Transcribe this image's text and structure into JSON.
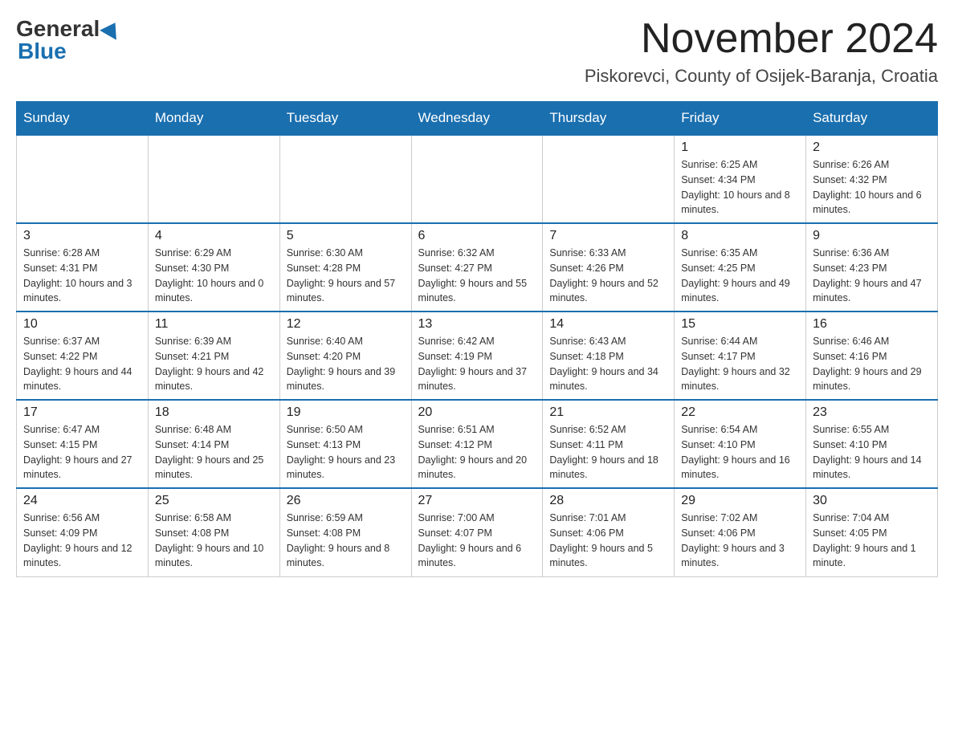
{
  "logo": {
    "general": "General",
    "blue": "Blue"
  },
  "title": "November 2024",
  "location": "Piskorevci, County of Osijek-Baranja, Croatia",
  "days_of_week": [
    "Sunday",
    "Monday",
    "Tuesday",
    "Wednesday",
    "Thursday",
    "Friday",
    "Saturday"
  ],
  "weeks": [
    {
      "days": [
        {
          "number": "",
          "info": ""
        },
        {
          "number": "",
          "info": ""
        },
        {
          "number": "",
          "info": ""
        },
        {
          "number": "",
          "info": ""
        },
        {
          "number": "",
          "info": ""
        },
        {
          "number": "1",
          "info": "Sunrise: 6:25 AM\nSunset: 4:34 PM\nDaylight: 10 hours and 8 minutes."
        },
        {
          "number": "2",
          "info": "Sunrise: 6:26 AM\nSunset: 4:32 PM\nDaylight: 10 hours and 6 minutes."
        }
      ]
    },
    {
      "days": [
        {
          "number": "3",
          "info": "Sunrise: 6:28 AM\nSunset: 4:31 PM\nDaylight: 10 hours and 3 minutes."
        },
        {
          "number": "4",
          "info": "Sunrise: 6:29 AM\nSunset: 4:30 PM\nDaylight: 10 hours and 0 minutes."
        },
        {
          "number": "5",
          "info": "Sunrise: 6:30 AM\nSunset: 4:28 PM\nDaylight: 9 hours and 57 minutes."
        },
        {
          "number": "6",
          "info": "Sunrise: 6:32 AM\nSunset: 4:27 PM\nDaylight: 9 hours and 55 minutes."
        },
        {
          "number": "7",
          "info": "Sunrise: 6:33 AM\nSunset: 4:26 PM\nDaylight: 9 hours and 52 minutes."
        },
        {
          "number": "8",
          "info": "Sunrise: 6:35 AM\nSunset: 4:25 PM\nDaylight: 9 hours and 49 minutes."
        },
        {
          "number": "9",
          "info": "Sunrise: 6:36 AM\nSunset: 4:23 PM\nDaylight: 9 hours and 47 minutes."
        }
      ]
    },
    {
      "days": [
        {
          "number": "10",
          "info": "Sunrise: 6:37 AM\nSunset: 4:22 PM\nDaylight: 9 hours and 44 minutes."
        },
        {
          "number": "11",
          "info": "Sunrise: 6:39 AM\nSunset: 4:21 PM\nDaylight: 9 hours and 42 minutes."
        },
        {
          "number": "12",
          "info": "Sunrise: 6:40 AM\nSunset: 4:20 PM\nDaylight: 9 hours and 39 minutes."
        },
        {
          "number": "13",
          "info": "Sunrise: 6:42 AM\nSunset: 4:19 PM\nDaylight: 9 hours and 37 minutes."
        },
        {
          "number": "14",
          "info": "Sunrise: 6:43 AM\nSunset: 4:18 PM\nDaylight: 9 hours and 34 minutes."
        },
        {
          "number": "15",
          "info": "Sunrise: 6:44 AM\nSunset: 4:17 PM\nDaylight: 9 hours and 32 minutes."
        },
        {
          "number": "16",
          "info": "Sunrise: 6:46 AM\nSunset: 4:16 PM\nDaylight: 9 hours and 29 minutes."
        }
      ]
    },
    {
      "days": [
        {
          "number": "17",
          "info": "Sunrise: 6:47 AM\nSunset: 4:15 PM\nDaylight: 9 hours and 27 minutes."
        },
        {
          "number": "18",
          "info": "Sunrise: 6:48 AM\nSunset: 4:14 PM\nDaylight: 9 hours and 25 minutes."
        },
        {
          "number": "19",
          "info": "Sunrise: 6:50 AM\nSunset: 4:13 PM\nDaylight: 9 hours and 23 minutes."
        },
        {
          "number": "20",
          "info": "Sunrise: 6:51 AM\nSunset: 4:12 PM\nDaylight: 9 hours and 20 minutes."
        },
        {
          "number": "21",
          "info": "Sunrise: 6:52 AM\nSunset: 4:11 PM\nDaylight: 9 hours and 18 minutes."
        },
        {
          "number": "22",
          "info": "Sunrise: 6:54 AM\nSunset: 4:10 PM\nDaylight: 9 hours and 16 minutes."
        },
        {
          "number": "23",
          "info": "Sunrise: 6:55 AM\nSunset: 4:10 PM\nDaylight: 9 hours and 14 minutes."
        }
      ]
    },
    {
      "days": [
        {
          "number": "24",
          "info": "Sunrise: 6:56 AM\nSunset: 4:09 PM\nDaylight: 9 hours and 12 minutes."
        },
        {
          "number": "25",
          "info": "Sunrise: 6:58 AM\nSunset: 4:08 PM\nDaylight: 9 hours and 10 minutes."
        },
        {
          "number": "26",
          "info": "Sunrise: 6:59 AM\nSunset: 4:08 PM\nDaylight: 9 hours and 8 minutes."
        },
        {
          "number": "27",
          "info": "Sunrise: 7:00 AM\nSunset: 4:07 PM\nDaylight: 9 hours and 6 minutes."
        },
        {
          "number": "28",
          "info": "Sunrise: 7:01 AM\nSunset: 4:06 PM\nDaylight: 9 hours and 5 minutes."
        },
        {
          "number": "29",
          "info": "Sunrise: 7:02 AM\nSunset: 4:06 PM\nDaylight: 9 hours and 3 minutes."
        },
        {
          "number": "30",
          "info": "Sunrise: 7:04 AM\nSunset: 4:05 PM\nDaylight: 9 hours and 1 minute."
        }
      ]
    }
  ]
}
